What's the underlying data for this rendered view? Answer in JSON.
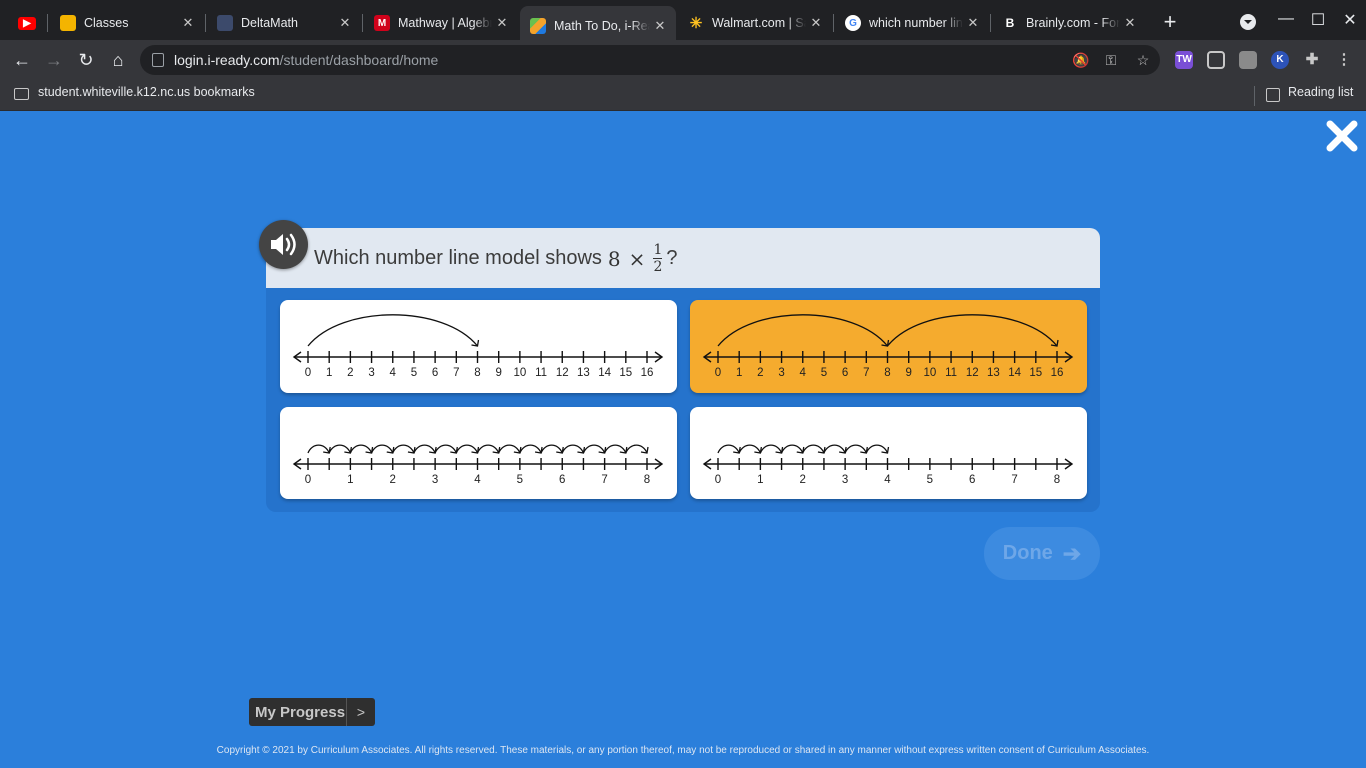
{
  "browser": {
    "tabs": [
      {
        "title": "",
        "favicon": "youtube-icon",
        "active": false
      },
      {
        "title": "Classes",
        "favicon": "google-classroom-icon",
        "active": false
      },
      {
        "title": "DeltaMath",
        "favicon": "deltamath-icon",
        "active": false
      },
      {
        "title": "Mathway | Algebra",
        "favicon": "mathway-icon",
        "active": false
      },
      {
        "title": "Math To Do, i-Ready",
        "favicon": "iready-icon",
        "active": true
      },
      {
        "title": "Walmart.com | Save",
        "favicon": "walmart-icon",
        "active": false
      },
      {
        "title": "which number line",
        "favicon": "google-icon",
        "active": false
      },
      {
        "title": "Brainly.com - For",
        "favicon": "brainly-icon",
        "active": false
      }
    ],
    "url_host": "login.i-ready.com",
    "url_path": "/student/dashboard/home",
    "bookmark_folder": "student.whiteville.k12.nc.us bookmarks",
    "reading_list": "Reading list",
    "colors": {
      "frame": "#202124",
      "toolbar": "#35363a"
    }
  },
  "question": {
    "text": "Which number line model shows",
    "whole": "8",
    "operator": "×",
    "numerator": "1",
    "denominator": "2",
    "end": "?"
  },
  "choices": [
    {
      "id": "A",
      "max": 16,
      "step": 1,
      "labels": [
        "0",
        "1",
        "2",
        "3",
        "4",
        "5",
        "6",
        "7",
        "8",
        "9",
        "10",
        "11",
        "12",
        "13",
        "14",
        "15",
        "16"
      ],
      "jumps": [
        [
          0,
          8
        ]
      ],
      "selected": false
    },
    {
      "id": "B",
      "max": 16,
      "step": 1,
      "labels": [
        "0",
        "1",
        "2",
        "3",
        "4",
        "5",
        "6",
        "7",
        "8",
        "9",
        "10",
        "11",
        "12",
        "13",
        "14",
        "15",
        "16"
      ],
      "jumps": [
        [
          0,
          8
        ],
        [
          8,
          16
        ]
      ],
      "selected": true
    },
    {
      "id": "C",
      "max": 8,
      "step": 0.5,
      "labels": [
        "0",
        "1",
        "2",
        "3",
        "4",
        "5",
        "6",
        "7",
        "8"
      ],
      "jumps": [
        [
          0,
          0.5
        ],
        [
          0.5,
          1
        ],
        [
          1,
          1.5
        ],
        [
          1.5,
          2
        ],
        [
          2,
          2.5
        ],
        [
          2.5,
          3
        ],
        [
          3,
          3.5
        ],
        [
          3.5,
          4
        ],
        [
          4,
          4.5
        ],
        [
          4.5,
          5
        ],
        [
          5,
          5.5
        ],
        [
          5.5,
          6
        ],
        [
          6,
          6.5
        ],
        [
          6.5,
          7
        ],
        [
          7,
          7.5
        ],
        [
          7.5,
          8
        ]
      ],
      "selected": false
    },
    {
      "id": "D",
      "max": 8,
      "step": 0.5,
      "labels": [
        "0",
        "1",
        "2",
        "3",
        "4",
        "5",
        "6",
        "7",
        "8"
      ],
      "jumps": [
        [
          0,
          0.5
        ],
        [
          0.5,
          1
        ],
        [
          1,
          1.5
        ],
        [
          1.5,
          2
        ],
        [
          2,
          2.5
        ],
        [
          2.5,
          3
        ],
        [
          3,
          3.5
        ],
        [
          3.5,
          4
        ]
      ],
      "selected": false
    }
  ],
  "done_label": "Done",
  "my_progress_label": "My Progress",
  "my_progress_chevron": ">",
  "copyright": "Copyright © 2021 by Curriculum Associates. All rights reserved. These materials, or any portion thereof, may not be reproduced or shared in any manner without express written consent of Curriculum Associates.",
  "colors": {
    "background": "#2b7fdb",
    "selected_card": "#f5ab2e",
    "card": "#ffffff"
  }
}
